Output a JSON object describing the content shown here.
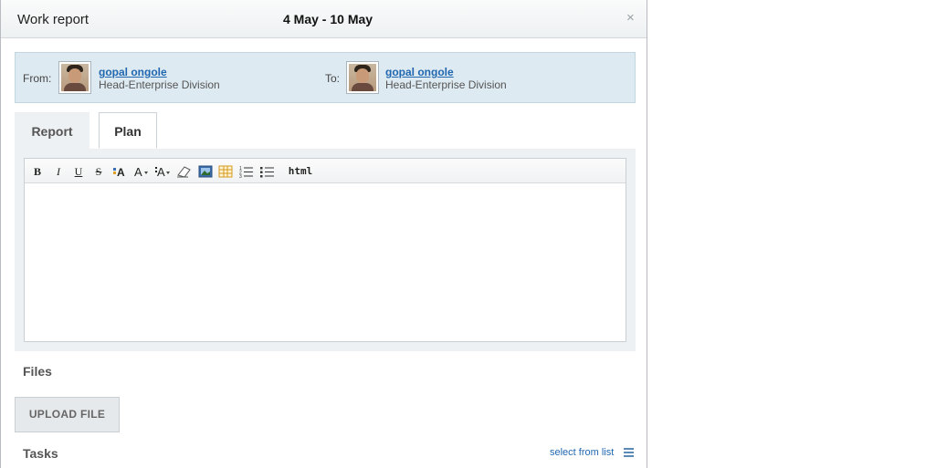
{
  "dialog": {
    "title": "Work report",
    "dates": "4 May - 10 May",
    "close_icon": "close-icon",
    "close_glyph": "×"
  },
  "from": {
    "label": "From:",
    "name": "gopal ongole",
    "role": "Head-Enterprise Division"
  },
  "to": {
    "label": "To:",
    "name": "gopal ongole",
    "role": "Head-Enterprise Division"
  },
  "tabs": [
    {
      "label": "Report",
      "active": false
    },
    {
      "label": "Plan",
      "active": true
    }
  ],
  "toolbar": {
    "bold": "B",
    "italic": "I",
    "underline": "U",
    "strike": "S",
    "font": "A",
    "size": "A",
    "color": "A",
    "html": "html",
    "icons": [
      "bold-icon",
      "italic-icon",
      "underline-icon",
      "strikethrough-icon",
      "font-family-icon",
      "font-size-icon",
      "font-color-icon",
      "eraser-icon",
      "image-icon",
      "table-icon",
      "ordered-list-icon",
      "unordered-list-icon",
      "html-source-icon"
    ]
  },
  "editor": {
    "content": ""
  },
  "files": {
    "label": "Files",
    "upload_label": "UPLOAD FILE"
  },
  "tasks": {
    "label": "Tasks",
    "select_label": "select from list",
    "menu_icon": "list-menu-icon"
  },
  "colors": {
    "link": "#2067b0",
    "people_bg": "#deeaf1",
    "tab_bg": "#eef1f3"
  }
}
